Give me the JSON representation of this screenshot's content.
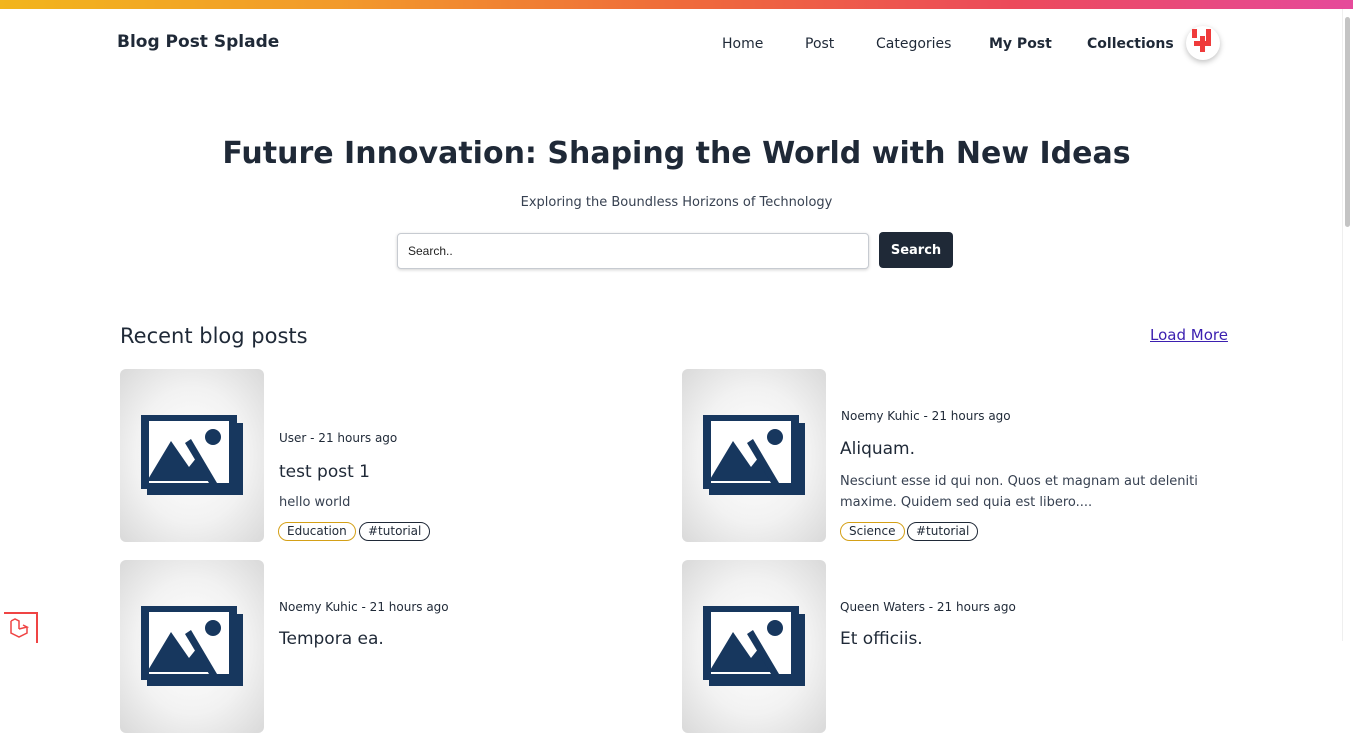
{
  "header": {
    "brand": "Blog Post Splade",
    "nav": [
      "Home",
      "Post",
      "Categories",
      "My Post",
      "Collections"
    ]
  },
  "hero": {
    "title": "Future Innovation: Shaping the World with New Ideas",
    "subtitle": "Exploring the Boundless Horizons of Technology",
    "search_placeholder": "Search..",
    "search_button": "Search"
  },
  "recent": {
    "title": "Recent blog posts",
    "load_more": "Load More",
    "posts": [
      {
        "meta": "User - 21 hours ago",
        "title": "test post 1",
        "excerpt": "hello world",
        "category": "Education",
        "tag": "#tutorial"
      },
      {
        "meta": "Noemy Kuhic - 21 hours ago",
        "title": "Aliquam.",
        "excerpt": "Nesciunt esse id qui non. Quos et magnam aut deleniti maxime. Quidem sed quia est libero....",
        "category": "Science",
        "tag": "#tutorial"
      },
      {
        "meta": "Noemy Kuhic - 21 hours ago",
        "title": "Tempora ea.",
        "excerpt": "",
        "category": "",
        "tag": ""
      },
      {
        "meta": "Queen Waters - 21 hours ago",
        "title": "Et officiis.",
        "excerpt": "",
        "category": "",
        "tag": ""
      }
    ]
  },
  "colors": {
    "accent": "#1f2937",
    "link": "#3b1fb0",
    "category_border": "#d4a017",
    "placeholder_icon": "#17375e"
  },
  "icons": {
    "avatar": "laravel-logo-icon",
    "thumbnail": "image-placeholder-icon"
  }
}
